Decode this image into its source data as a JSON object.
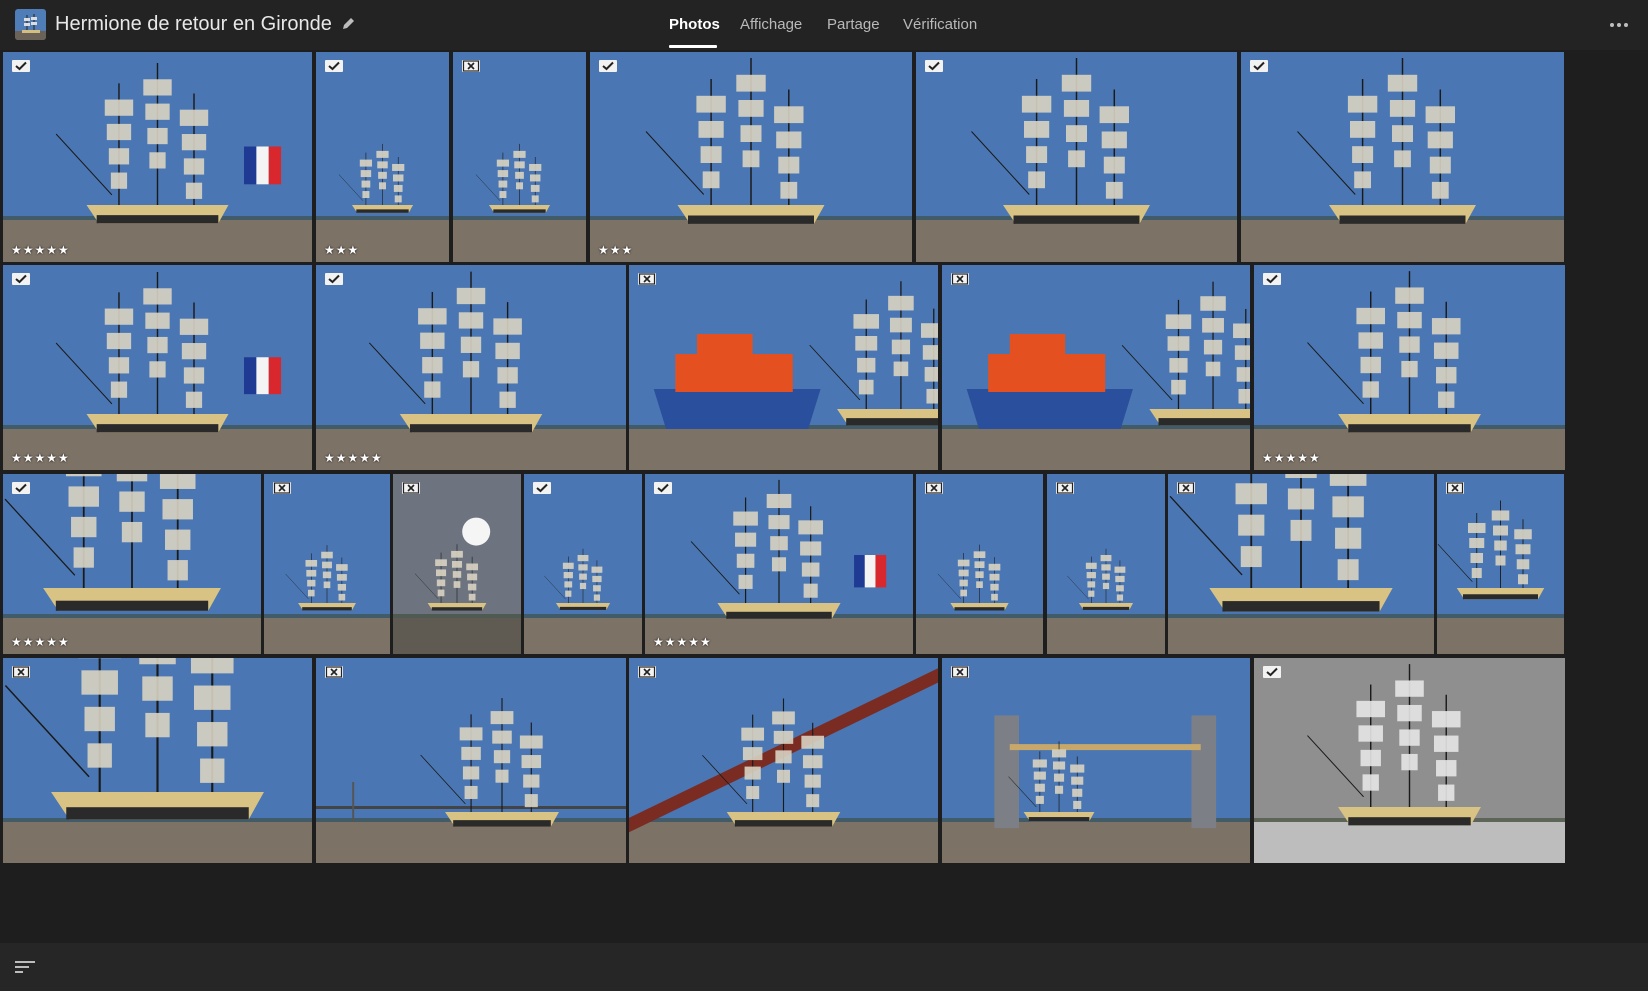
{
  "header": {
    "album_title": "Hermione de retour en Gironde",
    "album_thumb_icon": "album-cover-thumbnail",
    "edit_icon": "pencil-icon",
    "more_icon": "more-horizontal-icon",
    "tabs": [
      {
        "label": "Photos",
        "active": true
      },
      {
        "label": "Affichage",
        "active": false
      },
      {
        "label": "Partage",
        "active": false
      },
      {
        "label": "Vérification",
        "active": false
      }
    ]
  },
  "colors": {
    "background": "#1e1e1e",
    "topbar": "#232323",
    "sky": "#4a77b3",
    "water": "#7d7266",
    "hull_black": "#2b2a2a",
    "hull_gold": "#d9c384",
    "lifeboat_orange": "#e4501f",
    "lifeboat_blue": "#2a4f9c",
    "flag_blue": "#1f3a93",
    "flag_red": "#d8272d"
  },
  "photos": [
    {
      "id": 1,
      "flag": "picked",
      "stars": 5,
      "scene": "ship-flag"
    },
    {
      "id": 2,
      "flag": "picked",
      "stars": 3,
      "scene": "ship"
    },
    {
      "id": 3,
      "flag": "rejected",
      "stars": 0,
      "scene": "ship"
    },
    {
      "id": 4,
      "flag": "picked",
      "stars": 3,
      "scene": "ship"
    },
    {
      "id": 5,
      "flag": "picked",
      "stars": 0,
      "scene": "ship"
    },
    {
      "id": 6,
      "flag": "picked",
      "stars": 0,
      "scene": "ship"
    },
    {
      "id": 7,
      "flag": "picked",
      "stars": 5,
      "scene": "ship-flag"
    },
    {
      "id": 8,
      "flag": "picked",
      "stars": 5,
      "scene": "ship"
    },
    {
      "id": 9,
      "flag": "rejected",
      "stars": 0,
      "scene": "lifeboat"
    },
    {
      "id": 10,
      "flag": "rejected",
      "stars": 0,
      "scene": "lifeboat"
    },
    {
      "id": 11,
      "flag": "picked",
      "stars": 5,
      "scene": "ship"
    },
    {
      "id": 12,
      "flag": "picked",
      "stars": 5,
      "scene": "closeup"
    },
    {
      "id": 13,
      "flag": "rejected",
      "stars": 0,
      "scene": "ship"
    },
    {
      "id": 14,
      "flag": "rejected",
      "stars": 0,
      "scene": "sun"
    },
    {
      "id": 15,
      "flag": "picked",
      "stars": 0,
      "scene": "ship"
    },
    {
      "id": 16,
      "flag": "picked",
      "stars": 5,
      "scene": "ship-flag"
    },
    {
      "id": 17,
      "flag": "rejected",
      "stars": 0,
      "scene": "ship"
    },
    {
      "id": 18,
      "flag": "rejected",
      "stars": 0,
      "scene": "ship"
    },
    {
      "id": 19,
      "flag": "rejected",
      "stars": 0,
      "scene": "closeup"
    },
    {
      "id": 20,
      "flag": "rejected",
      "stars": 0,
      "scene": "closeup"
    },
    {
      "id": 21,
      "flag": "rejected",
      "stars": 0,
      "scene": "closeup"
    },
    {
      "id": 22,
      "flag": "rejected",
      "stars": 0,
      "scene": "bridge"
    },
    {
      "id": 23,
      "flag": "rejected",
      "stars": 0,
      "scene": "bridge-big"
    },
    {
      "id": 24,
      "flag": "rejected",
      "stars": 0,
      "scene": "liftbridge"
    },
    {
      "id": 25,
      "flag": "picked",
      "stars": 0,
      "scene": "bw"
    }
  ],
  "footer": {
    "sort_icon": "sort-filter-icon"
  }
}
